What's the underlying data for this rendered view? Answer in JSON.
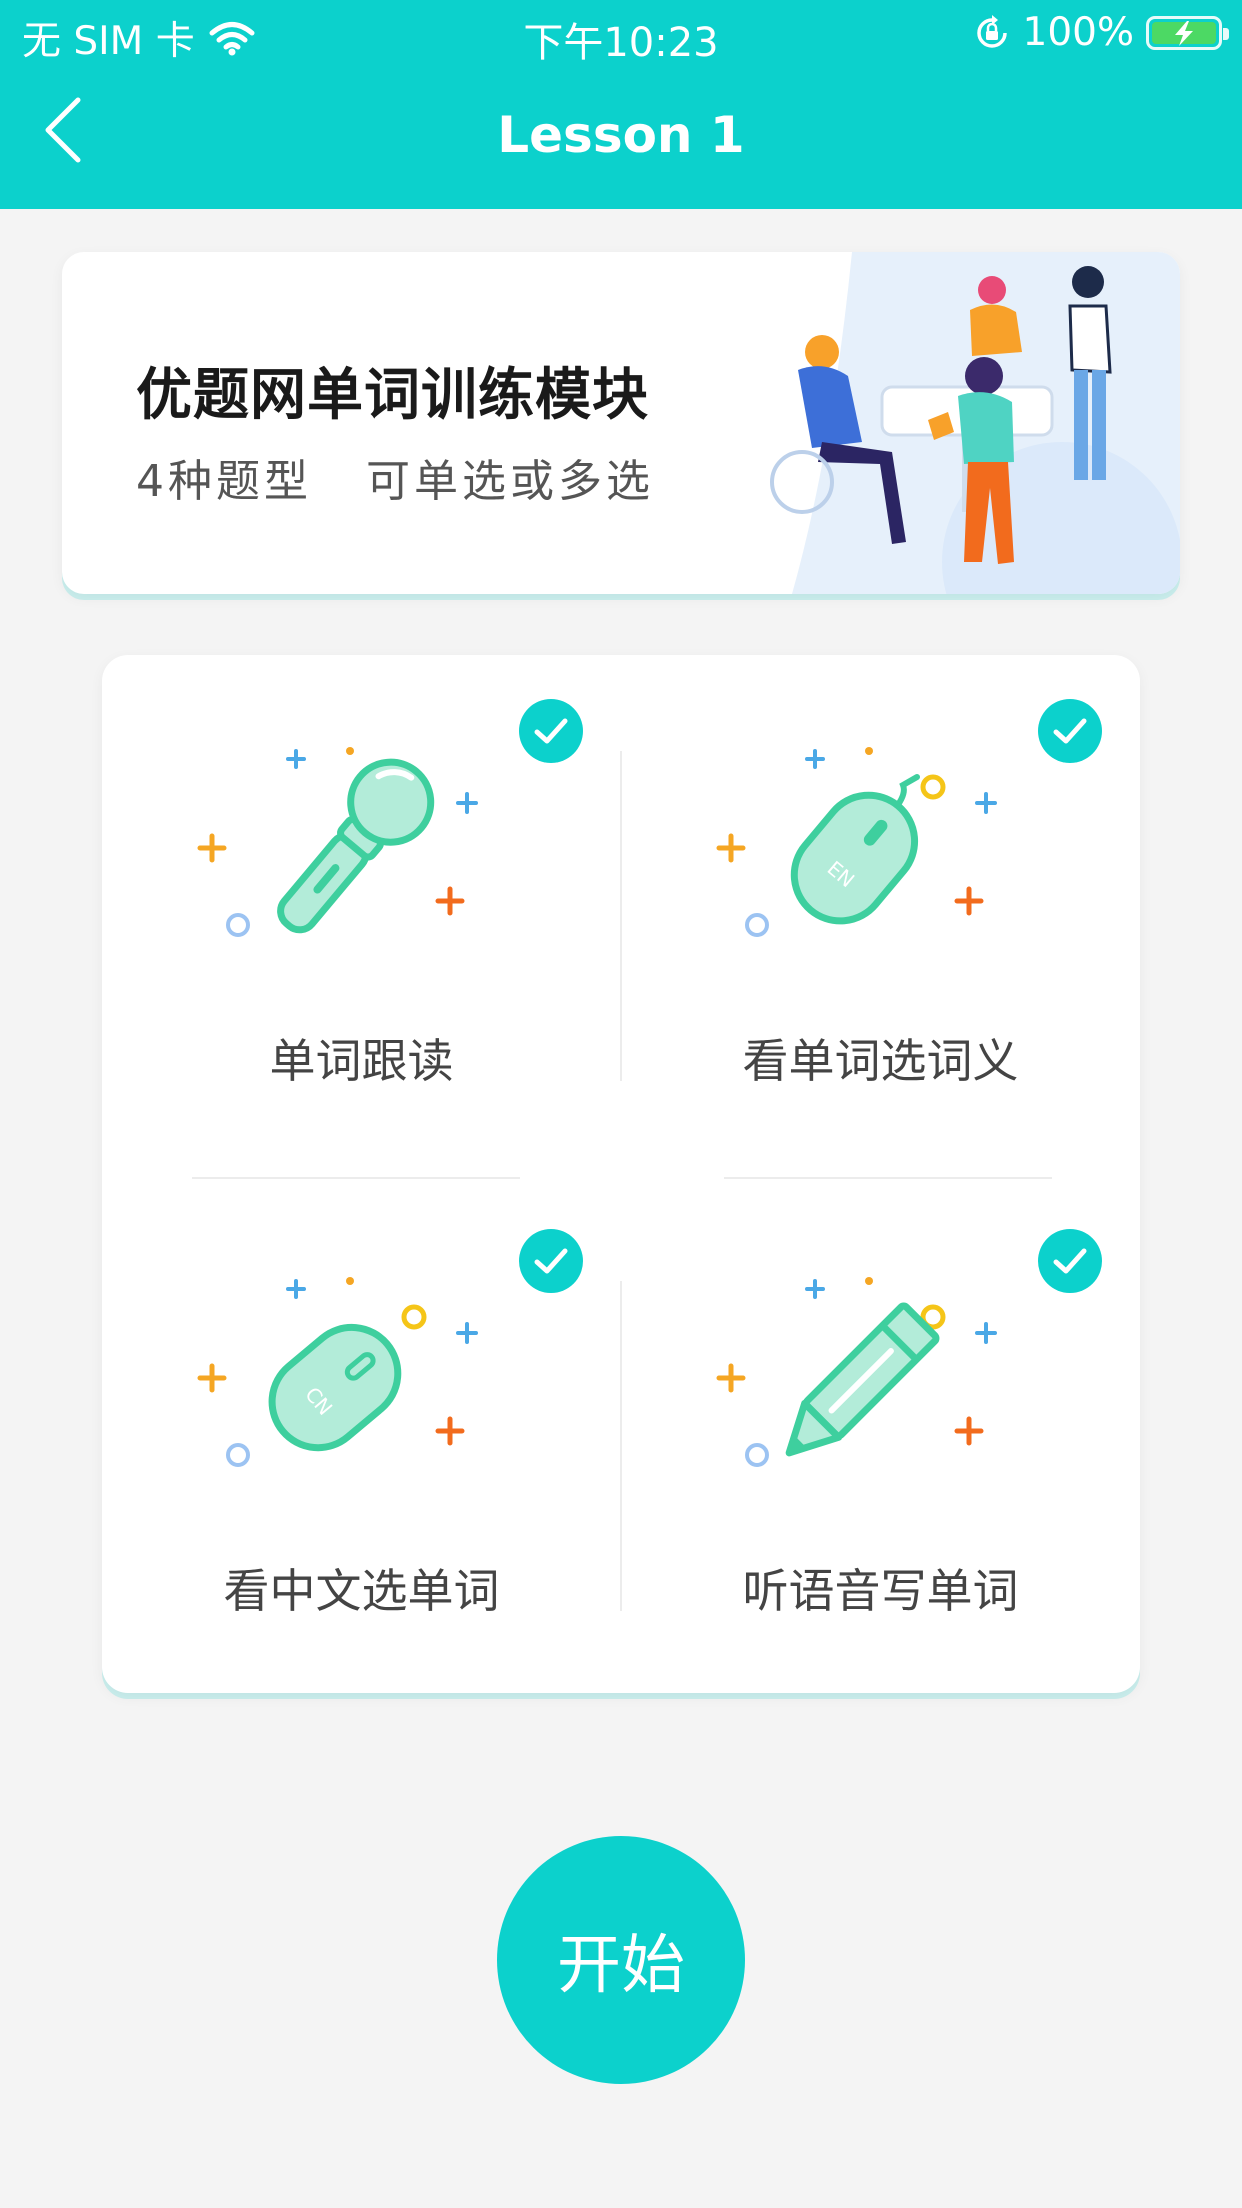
{
  "status_bar": {
    "carrier": "无 SIM 卡",
    "time": "下午10:23",
    "battery": "100%",
    "battery_level": 1.0
  },
  "nav": {
    "title": "Lesson 1",
    "back_icon": "chevron-left-icon"
  },
  "banner": {
    "title": "优题网单词训练模块",
    "subtitle": "4种题型   可单选或多选"
  },
  "options": [
    {
      "label": "单词跟读",
      "icon": "microphone-icon",
      "checked": true
    },
    {
      "label": "看单词选词义",
      "icon": "mouse-en-icon",
      "checked": true
    },
    {
      "label": "看中文选单词",
      "icon": "mouse-cn-icon",
      "checked": true
    },
    {
      "label": "听语音写单词",
      "icon": "pencil-icon",
      "checked": true
    }
  ],
  "start_button": {
    "label": "开始"
  },
  "colors": {
    "accent": "#0cd1cc",
    "icon_green": "#3ecf9e",
    "icon_fill": "#b3ecd9",
    "spark_orange": "#f5a623",
    "spark_red": "#f26b1d",
    "spark_blue": "#4aa8e6",
    "spark_yellow": "#f5c518"
  }
}
